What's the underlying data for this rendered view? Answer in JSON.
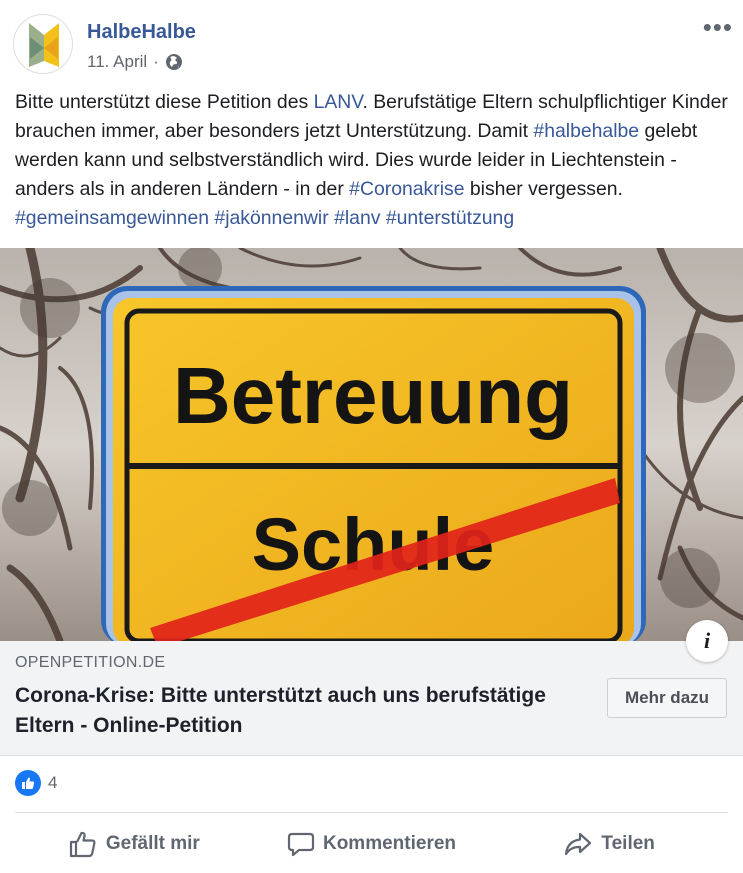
{
  "post": {
    "page_name": "HalbeHalbe",
    "date": "11. April",
    "separator": "·",
    "more_label": "•••",
    "text_1": "Bitte unterstützt diese Petition des ",
    "mention": "LANV",
    "text_2": ". Berufstätige Eltern schulpflichtiger Kinder brauchen immer, aber besonders jetzt Unterstützung. Damit ",
    "hashtag_1": "#halbehalbe",
    "text_3": " gelebt werden kann und selbstverständlich wird. Dies wurde leider in Liechtenstein - anders als in anderen Ländern - in der ",
    "hashtag_2": "#Coronakrise",
    "text_4": " bisher vergessen. ",
    "hashtag_3": "#gemeinsamgewinnen",
    "hashtag_4": "#jakönnenwir",
    "hashtag_5": "#lanv",
    "hashtag_6": "#unterstützung"
  },
  "image": {
    "sign_top": "Betreuung",
    "sign_bottom": "Schule"
  },
  "link_preview": {
    "domain": "OPENPETITION.DE",
    "title": "Corona-Krise: Bitte unterstützt auch uns berufstätige Eltern - Online-Petition",
    "cta": "Mehr dazu",
    "info": "i"
  },
  "reactions": {
    "count": "4"
  },
  "actions": {
    "like": "Gefällt mir",
    "comment": "Kommentieren",
    "share": "Teilen"
  },
  "colors": {
    "link": "#385898",
    "like_blue": "#1877f2",
    "sign_yellow": "#f3b216",
    "sign_red": "#e2231a"
  },
  "icons": {
    "avatar": "halbehalbe-logo",
    "privacy": "globe-icon",
    "reaction": "like-icon"
  }
}
